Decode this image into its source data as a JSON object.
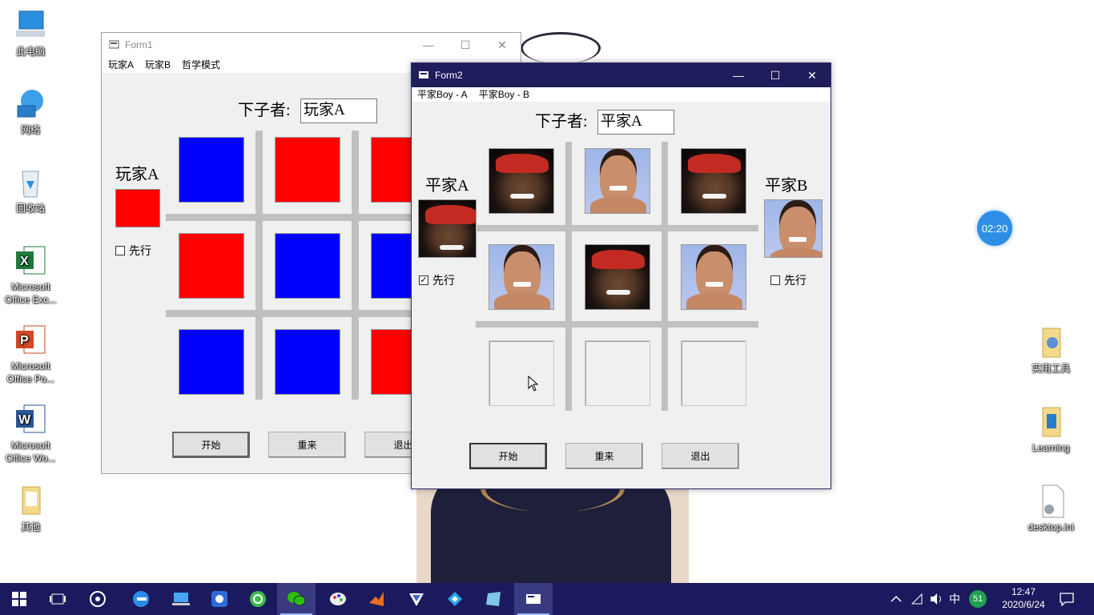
{
  "desktop": {
    "icons_left": [
      {
        "label": "此电脑",
        "icon": "computer-icon"
      },
      {
        "label": "网络",
        "icon": "network-icon"
      },
      {
        "label": "回收站",
        "icon": "recycle-bin-icon"
      },
      {
        "label": "Microsoft Office Exc...",
        "icon": "excel-icon"
      },
      {
        "label": "Microsoft Office Po...",
        "icon": "powerpoint-icon"
      },
      {
        "label": "Microsoft Office Wo...",
        "icon": "word-icon"
      },
      {
        "label": "其他",
        "icon": "folder-icon"
      }
    ],
    "icons_right": [
      {
        "label": "实用工具",
        "icon": "folder-icon"
      },
      {
        "label": "Learning",
        "icon": "folder-icon"
      },
      {
        "label": "desktop.ini",
        "icon": "settings-file-icon"
      }
    ],
    "timer": "02:20"
  },
  "form1": {
    "title": "Form1",
    "menu": [
      "玩家A",
      "玩家B",
      "哲学模式"
    ],
    "current_label": "下子者:",
    "current_value": "玩家A",
    "player_label": "玩家A",
    "player_color": "#ff0000",
    "first_move_label": "先行",
    "first_move_checked": false,
    "board": [
      "blue",
      "red",
      "red",
      "red",
      "blue",
      "blue",
      "blue",
      "blue",
      "red"
    ],
    "buttons": {
      "start": "开始",
      "restart": "重来",
      "exit": "退出"
    }
  },
  "form2": {
    "title": "Form2",
    "menu": [
      "平家Boy - A",
      "平家Boy - B"
    ],
    "current_label": "下子者:",
    "current_value": "平家A",
    "player_a_label": "平家A",
    "player_b_label": "平家B",
    "first_move_label_a": "先行",
    "first_move_a_checked": true,
    "first_move_label_b": "先行",
    "first_move_b_checked": false,
    "board": [
      "A",
      "B",
      "A",
      "B",
      "A",
      "B",
      "",
      "",
      ""
    ],
    "buttons": {
      "start": "开始",
      "restart": "重来",
      "exit": "退出"
    }
  },
  "taskbar": {
    "ime": "中",
    "badge": "51",
    "time": "12:47",
    "date": "2020/6/24"
  }
}
